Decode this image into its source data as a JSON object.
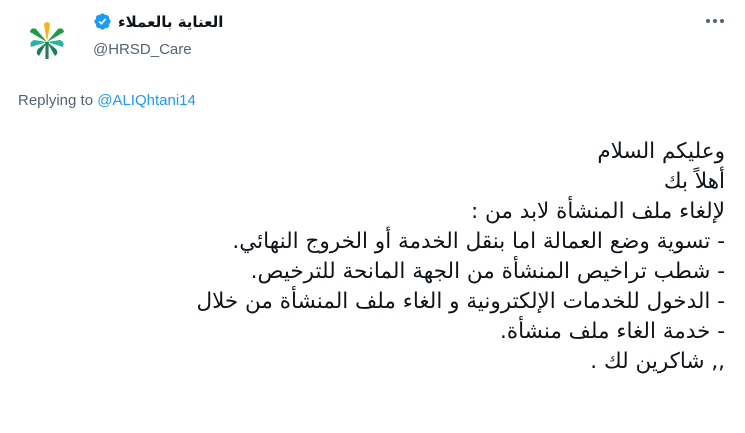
{
  "account": {
    "display_name": "العناية بالعملاء",
    "handle": "@HRSD_Care",
    "verified_icon": "verified-badge-icon",
    "avatar_icon": "hrsd-logo-icon",
    "accent_color": "#1d9bf0"
  },
  "reply": {
    "prefix": "Replying to ",
    "mention": "@ALIQhtani14"
  },
  "tweet": {
    "lines": [
      "وعليكم السلام",
      "أهلاً بك",
      "لإلغاء ملف المنشأة لابد من :",
      "- تسوية وضع العمالة اما بنقل الخدمة أو الخروج النهائي.",
      "- شطب تراخيص المنشأة من الجهة المانحة للترخيص.",
      "- الدخول للخدمات الإلكترونية و الغاء ملف المنشأة من خلال",
      "- خدمة الغاء ملف منشأة.",
      ",, شاكرين لك ."
    ]
  },
  "more_icon": "more-options-icon"
}
